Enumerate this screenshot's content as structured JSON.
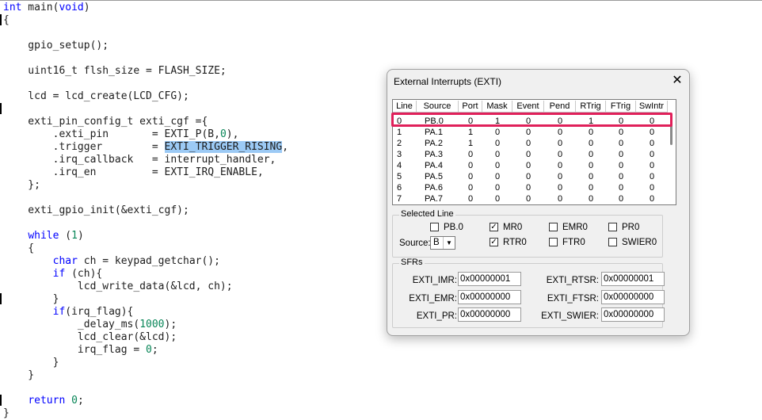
{
  "code": {
    "lines": [
      "int main(void)",
      "{",
      "",
      "    gpio_setup();",
      "",
      "    uint16_t flsh_size = FLASH_SIZE;",
      "",
      "    lcd = lcd_create(LCD_CFG);",
      "",
      "    exti_pin_config_t exti_cgf ={",
      "        .exti_pin       = EXTI_P(B,0),",
      "        .trigger        = ",
      "        .irq_callback   = interrupt_handler,",
      "        .irq_en         = EXTI_IRQ_ENABLE,",
      "    };",
      "",
      "    exti_gpio_init(&exti_cgf);",
      "",
      "    while (1)",
      "    {",
      "        char ch = keypad_getchar();",
      "        if (ch){",
      "            lcd_write_data(&lcd, ch);",
      "        }",
      "        if(irq_flag){",
      "            _delay_ms(1000);",
      "            lcd_clear(&lcd);",
      "            irq_flag = 0;",
      "        }",
      "    }",
      "",
      "    return 0;",
      "}"
    ],
    "highlight_text": "EXTI_TRIGGER_RISING",
    "highlight_suffix": ",",
    "colors": {
      "keyword": "#0000ff",
      "number": "#098658",
      "highlight": "#9ccaf5"
    }
  },
  "dialog": {
    "title": "External Interrupts (EXTI)",
    "close_glyph": "✕",
    "columns": [
      "Line",
      "Source",
      "Port",
      "Mask",
      "Event",
      "Pend",
      "RTrig",
      "FTrig",
      "SwIntr"
    ],
    "rows": [
      [
        "0",
        "PB.0",
        "0",
        "1",
        "0",
        "0",
        "1",
        "0",
        "0"
      ],
      [
        "1",
        "PA.1",
        "1",
        "0",
        "0",
        "0",
        "0",
        "0",
        "0"
      ],
      [
        "2",
        "PA.2",
        "1",
        "0",
        "0",
        "0",
        "0",
        "0",
        "0"
      ],
      [
        "3",
        "PA.3",
        "0",
        "0",
        "0",
        "0",
        "0",
        "0",
        "0"
      ],
      [
        "4",
        "PA.4",
        "0",
        "0",
        "0",
        "0",
        "0",
        "0",
        "0"
      ],
      [
        "5",
        "PA.5",
        "0",
        "0",
        "0",
        "0",
        "0",
        "0",
        "0"
      ],
      [
        "6",
        "PA.6",
        "0",
        "0",
        "0",
        "0",
        "0",
        "0",
        "0"
      ],
      [
        "7",
        "PA.7",
        "0",
        "0",
        "0",
        "0",
        "0",
        "0",
        "0"
      ]
    ],
    "highlight_color": "#e0205a",
    "selected_line": {
      "title": "Selected Line",
      "checkboxes": [
        {
          "label": "PB.0",
          "checked": false
        },
        {
          "label": "MR0",
          "checked": true
        },
        {
          "label": "EMR0",
          "checked": false
        },
        {
          "label": "PR0",
          "checked": false
        },
        {
          "label": "RTR0",
          "checked": true
        },
        {
          "label": "FTR0",
          "checked": false
        },
        {
          "label": "SWIER0",
          "checked": false
        }
      ],
      "source_label": "Source:",
      "source_value": "B"
    },
    "sfrs": {
      "title": "SFRs",
      "left": [
        {
          "label": "EXTI_IMR:",
          "value": "0x00000001"
        },
        {
          "label": "EXTI_EMR:",
          "value": "0x00000000"
        },
        {
          "label": "EXTI_PR:",
          "value": "0x00000000"
        }
      ],
      "right": [
        {
          "label": "EXTI_RTSR:",
          "value": "0x00000001"
        },
        {
          "label": "EXTI_FTSR:",
          "value": "0x00000000"
        },
        {
          "label": "EXTI_SWIER:",
          "value": "0x00000000"
        }
      ]
    }
  }
}
